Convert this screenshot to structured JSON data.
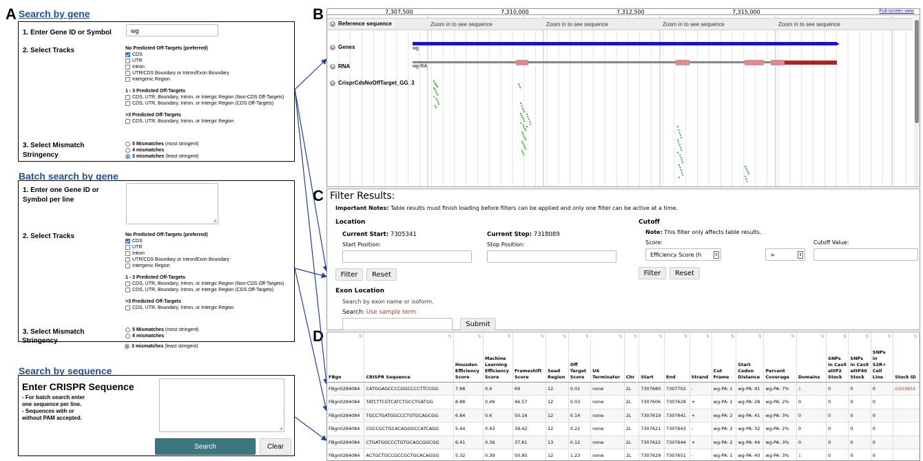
{
  "panel_labels": {
    "a": "A",
    "b": "B",
    "c": "C",
    "d": "D"
  },
  "search_gene": {
    "title": "Search by gene",
    "step1": "1. Enter Gene ID or Symbol",
    "input_value": "wg",
    "step2": "2. Select Tracks",
    "no_pred": "No Predicted Off-Targets (preferred)",
    "opt_cds": "CDS",
    "opt_utr": "UTR",
    "opt_intron": "Intron",
    "opt_boundary": "UTR/CDS Boundary or Intron/Exon Boundary",
    "opt_intergenic": "Intergenic Region",
    "pred13": "1 - 3 Predicted Off-Targets",
    "opt13a": "CDS, UTR, Boundary, Intron, or Intergic Region (Non-CDS Off-Targets)",
    "opt13b": "CDS, UTR, Boundary, Intron, or Intergic Region (CDS Off-Targets)",
    "pred3": ">3 Predicted Off-Targets",
    "opt3": "CDS, UTR, Boundary, Intron, or Intergic Region",
    "step3a": "3. Select Mismatch",
    "step3b": "Stringency",
    "mm5": "5 Mismatches",
    "mm5n": "(most stringent)",
    "mm4": "4 mismatches",
    "mm3": "3 mismatches",
    "mm3n": "(least stringent)"
  },
  "batch": {
    "title": "Batch search by gene",
    "step1a": "1. Enter one Gene ID or",
    "step1b": "Symbol per line",
    "step2": "2. Select Tracks",
    "no_pred": "No Predicted Off-Targets (preferred)",
    "opt_cds": "CDS",
    "opt_utr": "UTR",
    "opt_intron": "Intron",
    "opt_boundary": "UTR/CDS Boundary or Intron/Exon Boundary",
    "opt_intergenic": "Intergenic Region",
    "pred13": "1 - 3 Predicted Off-Targets",
    "opt13a": "CDS, UTR, Boundary, Intron, or Intergic Region (Non-CDS Off-Targets)",
    "opt13b": "CDS, UTR, Boundary, Intron, or Intergic Region (CDS Off-Targets)",
    "pred3": ">3 Predicted Off-Targets",
    "opt3": "CDS, UTR, Boundary, Intron, or Intergic Region",
    "step3a": "3. Select Mismatch",
    "step3b": "Stringency",
    "mm5": "5 Mismatches",
    "mm5n": "(most stringent)",
    "mm4": "4 mismatches",
    "mm3": "3 mismatches",
    "mm3n": "(least stringent)"
  },
  "seq": {
    "title": "Search by sequence",
    "heading": "Enter CRISPR Sequence",
    "n1": "- For batch search enter",
    "n2": "one sequence per line.",
    "n3": "- Sequences with or",
    "n4": "without PAM accepted.",
    "search": "Search",
    "clear": "Clear"
  },
  "browser": {
    "ticks": [
      "7,307,500",
      "7,310,000",
      "7,312,500",
      "7,315,000"
    ],
    "fullscreen": "Full-screen view",
    "ref_label": "Reference sequence",
    "zoom_msg": "Zoom in to see sequence",
    "genes_label": "Genes",
    "rna_label": "RNA",
    "crispr_label": "CrisprCdsNoOffTarget_GG_3",
    "gene_name": "wg",
    "rna_name": "wg-RA"
  },
  "filter": {
    "title": "Filter Results:",
    "notes_label": "Important Notes:",
    "notes_text": "Table results must finish loading before filters can be applied and only one filter can be active at a time.",
    "location": "Location",
    "cur_start_label": "Current Start:",
    "cur_start": "7305341",
    "cur_stop_label": "Current Stop:",
    "cur_stop": "7318089",
    "start_pos": "Start Position:",
    "stop_pos": "Stop Position:",
    "filter_btn": "Filter",
    "reset_btn": "Reset",
    "cutoff": "Cutoff",
    "note_label": "Note:",
    "note_text": "This filter only affects table results.",
    "score_label": "Score:",
    "score_value": "Efficiency Score (h",
    "op_value": ">",
    "cutoff_value_label": "Cutoff Value:",
    "exon": "Exon Location",
    "exon_desc": "Search by exon name or isoform.",
    "search_label": "Search:",
    "sample": "Use sample term",
    "submit": "Submit"
  },
  "table": {
    "headers": [
      "FBgn",
      "CRISPR Sequence",
      "Housden Efficiency Score",
      "Machine Learning Efficiency Score",
      "Frameshift Score",
      "Seed Region",
      "Off Target Score",
      "U6 Terminator",
      "Chr",
      "Start",
      "End",
      "Strand",
      "Cut Frame",
      "Start Codon Distance",
      "Percent Coverage",
      "Domains",
      "SNPs in Cas9 attP2 Stock",
      "SNPs in Cas9 attP40 Stock",
      "SNPs in S2R+ Cell Line",
      "Stock ID"
    ],
    "rows": [
      [
        "FBgn0284084",
        "CATGGAGCCCCGGCCCCTTCCGG",
        "7.98",
        "0.4",
        "69",
        "12",
        "0.01",
        "none",
        "2L",
        "7307680",
        "7307702",
        "-",
        "wg-PA: 1",
        "wg-PA: 91",
        "wg-PA: 7%",
        "1",
        "0",
        "0",
        "0",
        "GS03854"
      ],
      [
        "FBgn0284084",
        "TATCTTCGTCATCTGCCTGATGG",
        "8.88",
        "0.49",
        "46.57",
        "12",
        "0.03",
        "none",
        "2L",
        "7307606",
        "7307628",
        "+",
        "wg-PA: 1",
        "wg-PA: 28",
        "wg-PA: 2%",
        "0",
        "0",
        "0",
        "0",
        ""
      ],
      [
        "FBgn0284084",
        "TGCCTGATGGCCCTGTGCAGCGG",
        "6.84",
        "0.6",
        "50.16",
        "12",
        "0.14",
        "none",
        "2L",
        "7307619",
        "7307641",
        "+",
        "wg-PA: 2",
        "wg-PA: 41",
        "wg-PA: 3%",
        "0",
        "0",
        "0",
        "0",
        ""
      ],
      [
        "FBgn0284084",
        "CGCCGCTGCACAGGGCCATCAGG",
        "5.44",
        "0.43",
        "39.42",
        "12",
        "0.22",
        "none",
        "2L",
        "7307621",
        "7307643",
        "-",
        "wg-PA: 2",
        "wg-PA: 32",
        "wg-PA: 2%",
        "0",
        "0",
        "0",
        "0",
        ""
      ],
      [
        "FBgn0284084",
        "CTGATGGCCCTGTGCAGCGGCGG",
        "6.41",
        "0.39",
        "37.61",
        "13",
        "0.12",
        "none",
        "2L",
        "7307622",
        "7307644",
        "+",
        "wg-PA: 2",
        "wg-PA: 44",
        "wg-PA: 3%",
        "0",
        "0",
        "0",
        "0",
        ""
      ],
      [
        "FBgn0284084",
        "ACTGCTGCCGCCGCTGCACAGGG",
        "5.32",
        "0.39",
        "50.85",
        "12",
        "1.23",
        "none",
        "2L",
        "7307629",
        "7307651",
        "-",
        "wg-PA: 1",
        "wg-PA: 40",
        "wg-PA: 3%",
        "1",
        "0",
        "0",
        "0",
        ""
      ]
    ]
  },
  "colors": {
    "title_blue": "#1d4fa3",
    "gene_blue": "#1010e0",
    "exon_pink": "#e08b8b",
    "utr_red": "#b22222",
    "crispr_green": "#3cb43c",
    "arrow_blue": "#1d3fa8",
    "link_red": "#c0392b",
    "button_teal": "#3c7680"
  }
}
